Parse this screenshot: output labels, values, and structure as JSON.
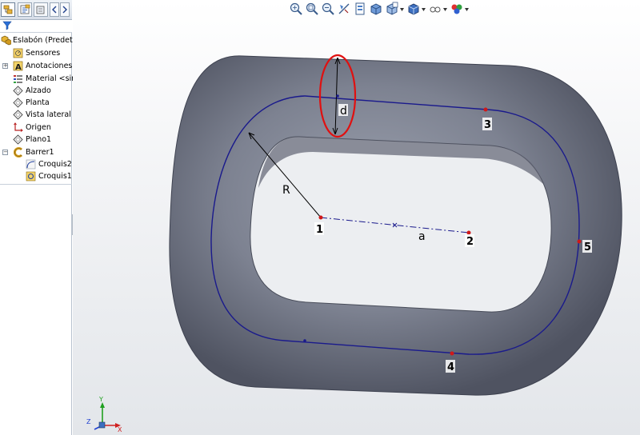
{
  "feature_tree": {
    "root_label": "Eslabón  (Predete",
    "items": [
      {
        "label": "Sensores"
      },
      {
        "label": "Anotaciones"
      },
      {
        "label": "Material <sin"
      },
      {
        "label": "Alzado"
      },
      {
        "label": "Planta"
      },
      {
        "label": "Vista lateral"
      },
      {
        "label": "Origen"
      },
      {
        "label": "Plano1"
      },
      {
        "label": "Barrer1"
      },
      {
        "label": "Croquis2"
      },
      {
        "label": "Croquis1"
      }
    ]
  },
  "model": {
    "labels": {
      "d": "d",
      "R": "R",
      "a": "a",
      "p1": "1",
      "p2": "2",
      "p3": "3",
      "p4": "4",
      "p5": "5"
    }
  },
  "triad": {
    "x": "X",
    "y": "Y",
    "z": "Z"
  },
  "colors": {
    "model_body": "#7d8291",
    "sketch_line": "#1a1a8c",
    "highlight_ellipse": "#e01010",
    "point": "#d01818"
  }
}
